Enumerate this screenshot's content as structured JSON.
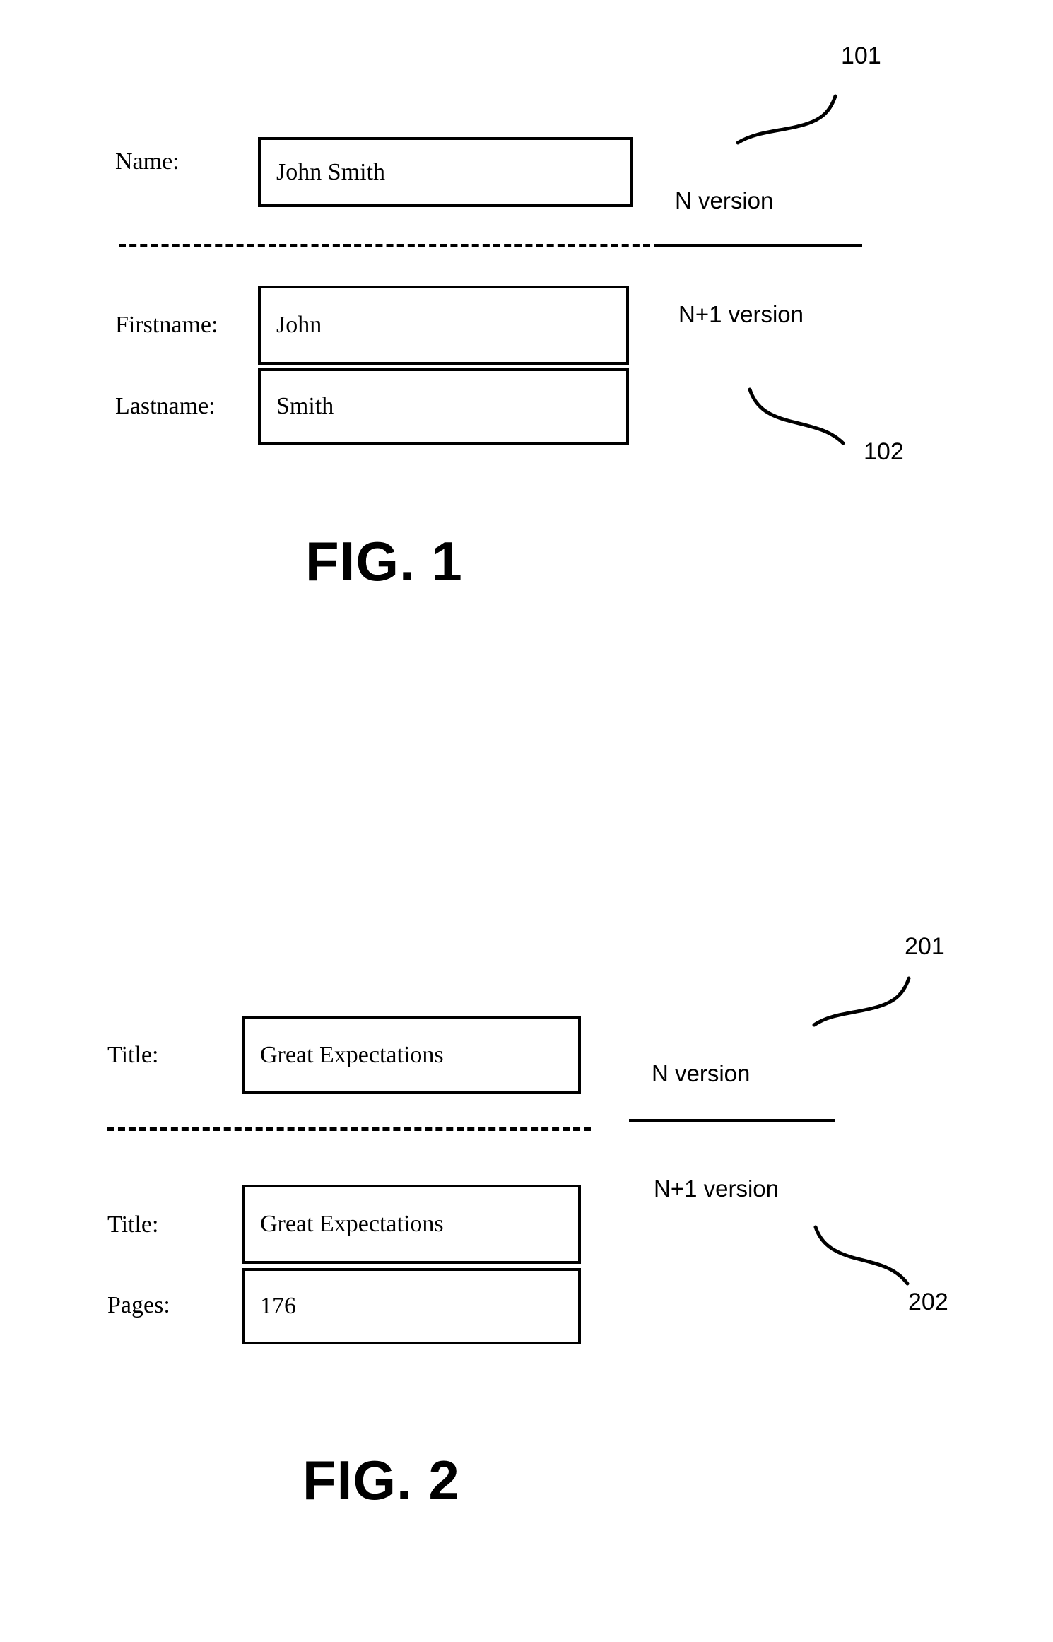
{
  "document": {
    "type": "patent-drawing-sheet",
    "figures": [
      {
        "id": "fig1",
        "caption": "FIG. 1",
        "upper_version_label": "N version",
        "lower_version_label": "N+1 version",
        "upper_ref_numeral": "101",
        "lower_ref_numeral": "102",
        "upper_rows": [
          {
            "label": "Name:",
            "value": "John Smith"
          }
        ],
        "lower_rows": [
          {
            "label": "Firstname:",
            "value": "John"
          },
          {
            "label": "Lastname:",
            "value": "Smith"
          }
        ]
      },
      {
        "id": "fig2",
        "caption": "FIG. 2",
        "upper_version_label": "N version",
        "lower_version_label": "N+1 version",
        "upper_ref_numeral": "201",
        "lower_ref_numeral": "202",
        "upper_rows": [
          {
            "label": "Title:",
            "value": "Great Expectations"
          }
        ],
        "lower_rows": [
          {
            "label": "Title:",
            "value": "Great Expectations"
          },
          {
            "label": "Pages:",
            "value": "176"
          }
        ]
      }
    ],
    "colors": {
      "ink": "#000000",
      "paper": "#ffffff"
    }
  }
}
